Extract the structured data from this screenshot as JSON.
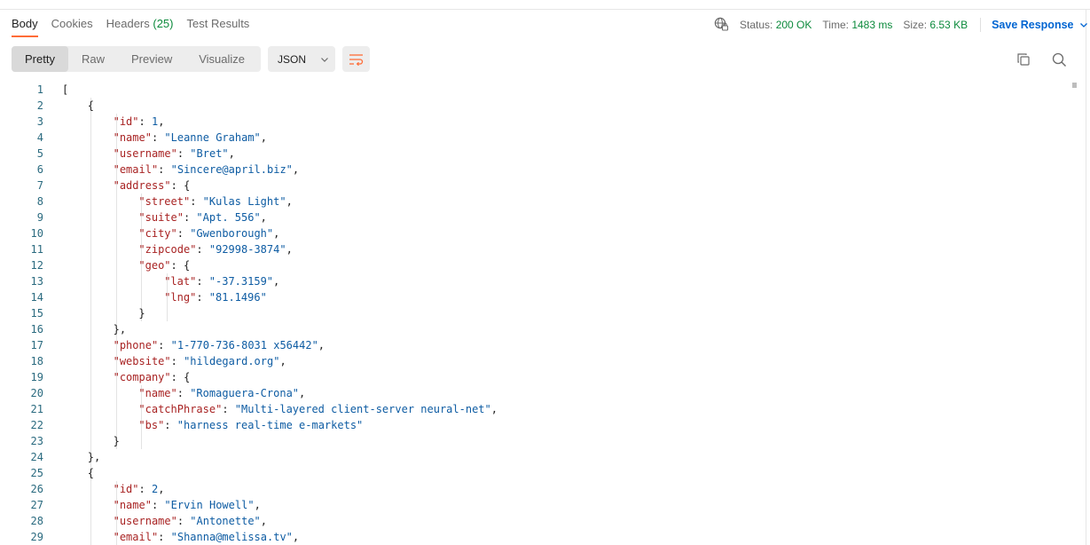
{
  "tabs": [
    {
      "label": "Body"
    },
    {
      "label": "Cookies"
    },
    {
      "label": "Headers",
      "count": "(25)"
    },
    {
      "label": "Test Results"
    }
  ],
  "meta": {
    "status_label": "Status:",
    "status_value": "200 OK",
    "time_label": "Time:",
    "time_value": "1483 ms",
    "size_label": "Size:",
    "size_value": "6.53 KB",
    "save_label": "Save Response"
  },
  "view_modes": [
    "Pretty",
    "Raw",
    "Preview",
    "Visualize"
  ],
  "active_view_mode": "Pretty",
  "format_select": "JSON",
  "icons": {
    "globe": "globe-icon",
    "save_dropdown": "chevron-down-icon",
    "format_dropdown": "chevron-down-icon",
    "wrap": "wrap-lines-icon",
    "copy": "copy-icon",
    "search": "search-icon"
  },
  "colors": {
    "accent": "#ff6c37",
    "link": "#0265d2",
    "success": "#0c8a3c",
    "json_key": "#a82323",
    "json_value": "#0e5ca3",
    "line_number": "#2a6a7f"
  },
  "code_lines": [
    {
      "n": "1",
      "t": [
        [
          "p",
          "["
        ]
      ]
    },
    {
      "n": "2",
      "t": [
        [
          "p",
          "{"
        ]
      ]
    },
    {
      "n": "3",
      "t": [
        [
          "k",
          "\"id\""
        ],
        [
          "p",
          ": "
        ],
        [
          "n",
          "1"
        ],
        [
          "p",
          ","
        ]
      ]
    },
    {
      "n": "4",
      "t": [
        [
          "k",
          "\"name\""
        ],
        [
          "p",
          ": "
        ],
        [
          "s",
          "\"Leanne Graham\""
        ],
        [
          "p",
          ","
        ]
      ]
    },
    {
      "n": "5",
      "t": [
        [
          "k",
          "\"username\""
        ],
        [
          "p",
          ": "
        ],
        [
          "s",
          "\"Bret\""
        ],
        [
          "p",
          ","
        ]
      ]
    },
    {
      "n": "6",
      "t": [
        [
          "k",
          "\"email\""
        ],
        [
          "p",
          ": "
        ],
        [
          "s",
          "\"Sincere@april.biz\""
        ],
        [
          "p",
          ","
        ]
      ]
    },
    {
      "n": "7",
      "t": [
        [
          "k",
          "\"address\""
        ],
        [
          "p",
          ": {"
        ]
      ]
    },
    {
      "n": "8",
      "t": [
        [
          "k",
          "\"street\""
        ],
        [
          "p",
          ": "
        ],
        [
          "s",
          "\"Kulas Light\""
        ],
        [
          "p",
          ","
        ]
      ]
    },
    {
      "n": "9",
      "t": [
        [
          "k",
          "\"suite\""
        ],
        [
          "p",
          ": "
        ],
        [
          "s",
          "\"Apt. 556\""
        ],
        [
          "p",
          ","
        ]
      ]
    },
    {
      "n": "10",
      "t": [
        [
          "k",
          "\"city\""
        ],
        [
          "p",
          ": "
        ],
        [
          "s",
          "\"Gwenborough\""
        ],
        [
          "p",
          ","
        ]
      ]
    },
    {
      "n": "11",
      "t": [
        [
          "k",
          "\"zipcode\""
        ],
        [
          "p",
          ": "
        ],
        [
          "s",
          "\"92998-3874\""
        ],
        [
          "p",
          ","
        ]
      ]
    },
    {
      "n": "12",
      "t": [
        [
          "k",
          "\"geo\""
        ],
        [
          "p",
          ": {"
        ]
      ]
    },
    {
      "n": "13",
      "t": [
        [
          "k",
          "\"lat\""
        ],
        [
          "p",
          ": "
        ],
        [
          "s",
          "\"-37.3159\""
        ],
        [
          "p",
          ","
        ]
      ]
    },
    {
      "n": "14",
      "t": [
        [
          "k",
          "\"lng\""
        ],
        [
          "p",
          ": "
        ],
        [
          "s",
          "\"81.1496\""
        ]
      ]
    },
    {
      "n": "15",
      "t": [
        [
          "p",
          "}"
        ]
      ]
    },
    {
      "n": "16",
      "t": [
        [
          "p",
          "},"
        ]
      ]
    },
    {
      "n": "17",
      "t": [
        [
          "k",
          "\"phone\""
        ],
        [
          "p",
          ": "
        ],
        [
          "s",
          "\"1-770-736-8031 x56442\""
        ],
        [
          "p",
          ","
        ]
      ]
    },
    {
      "n": "18",
      "t": [
        [
          "k",
          "\"website\""
        ],
        [
          "p",
          ": "
        ],
        [
          "s",
          "\"hildegard.org\""
        ],
        [
          "p",
          ","
        ]
      ]
    },
    {
      "n": "19",
      "t": [
        [
          "k",
          "\"company\""
        ],
        [
          "p",
          ": {"
        ]
      ]
    },
    {
      "n": "20",
      "t": [
        [
          "k",
          "\"name\""
        ],
        [
          "p",
          ": "
        ],
        [
          "s",
          "\"Romaguera-Crona\""
        ],
        [
          "p",
          ","
        ]
      ]
    },
    {
      "n": "21",
      "t": [
        [
          "k",
          "\"catchPhrase\""
        ],
        [
          "p",
          ": "
        ],
        [
          "s",
          "\"Multi-layered client-server neural-net\""
        ],
        [
          "p",
          ","
        ]
      ]
    },
    {
      "n": "22",
      "t": [
        [
          "k",
          "\"bs\""
        ],
        [
          "p",
          ": "
        ],
        [
          "s",
          "\"harness real-time e-markets\""
        ]
      ]
    },
    {
      "n": "23",
      "t": [
        [
          "p",
          "}"
        ]
      ]
    },
    {
      "n": "24",
      "t": [
        [
          "p",
          "},"
        ]
      ]
    },
    {
      "n": "25",
      "t": [
        [
          "p",
          "{"
        ]
      ]
    },
    {
      "n": "26",
      "t": [
        [
          "k",
          "\"id\""
        ],
        [
          "p",
          ": "
        ],
        [
          "n",
          "2"
        ],
        [
          "p",
          ","
        ]
      ]
    },
    {
      "n": "27",
      "t": [
        [
          "k",
          "\"name\""
        ],
        [
          "p",
          ": "
        ],
        [
          "s",
          "\"Ervin Howell\""
        ],
        [
          "p",
          ","
        ]
      ]
    },
    {
      "n": "28",
      "t": [
        [
          "k",
          "\"username\""
        ],
        [
          "p",
          ": "
        ],
        [
          "s",
          "\"Antonette\""
        ],
        [
          "p",
          ","
        ]
      ]
    },
    {
      "n": "29",
      "t": [
        [
          "k",
          "\"email\""
        ],
        [
          "p",
          ": "
        ],
        [
          "s",
          "\"Shanna@melissa.tv\""
        ],
        [
          "p",
          ","
        ]
      ]
    }
  ]
}
